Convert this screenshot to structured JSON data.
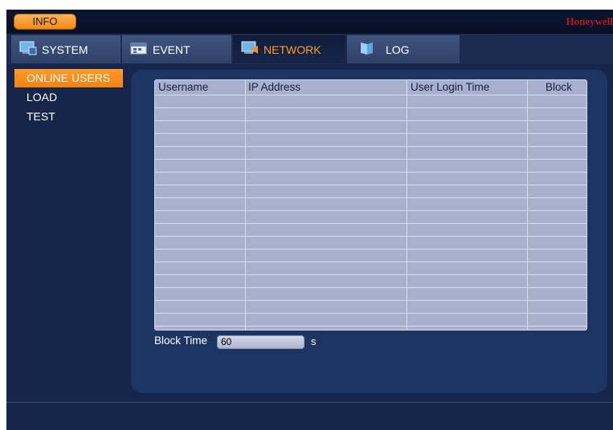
{
  "header": {
    "info_label": "INFO",
    "brand": "Honeywell"
  },
  "tabs": [
    {
      "label": "SYSTEM",
      "icon": "monitor-icon"
    },
    {
      "label": "EVENT",
      "icon": "event-icon"
    },
    {
      "label": "NETWORK",
      "icon": "network-icon",
      "active": true
    },
    {
      "label": "LOG",
      "icon": "log-icon"
    }
  ],
  "sidebar": {
    "items": [
      {
        "label": "ONLINE USERS",
        "active": true
      },
      {
        "label": "LOAD"
      },
      {
        "label": "TEST"
      }
    ]
  },
  "table": {
    "columns": [
      "Username",
      "IP Address",
      "User Login Time",
      "Block"
    ],
    "rows": []
  },
  "block_time": {
    "label": "Block Time",
    "value": "60",
    "unit": "s"
  },
  "colors": {
    "accent": "#ff9b2a",
    "brand": "#c0171b",
    "background": "#16264a"
  }
}
